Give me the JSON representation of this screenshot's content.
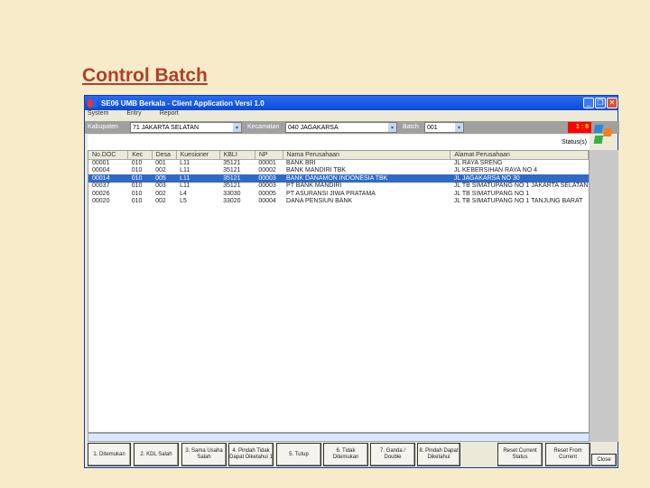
{
  "slide_title": "Control Batch",
  "window": {
    "title": "SE06 UMB Berkala - Client Application Versi 1.0"
  },
  "menu": [
    "System",
    "Entry",
    "Report"
  ],
  "filter": {
    "kab_label": "Kabupaten",
    "kab_value": "71 JAKARTA SELATAN",
    "kec_label": "Kecamatan",
    "kec_value": "040 JAGAKARSA",
    "batch_label": "Batch",
    "batch_value": "001",
    "total": "1 : 8"
  },
  "status_label": "Status(s)",
  "table": {
    "headers": [
      "No.DOC",
      "Kec",
      "Desa",
      "Kuesioner",
      "KBLI",
      "NP",
      "Nama Perusahaan",
      "Alamat Perusahaan"
    ],
    "rows": [
      [
        "00001",
        "010",
        "001",
        "L11",
        "35121",
        "00001",
        "BANK BRI",
        "JL RAYA SRENG"
      ],
      [
        "00004",
        "010",
        "002",
        "L11",
        "35121",
        "00002",
        "BANK MANDIRI TBK",
        "JL KEBERSIHAN RAYA NO 4"
      ],
      [
        "00014",
        "010",
        "005",
        "L11",
        "35121",
        "00003",
        "BANK DANAMON INDONESIA TBK",
        "JL JAGAKARSA NO 30"
      ],
      [
        "00037",
        "010",
        "003",
        "L11",
        "35121",
        "00003",
        "PT BANK MANDIRI",
        "JL TB SIMATUPANG NO 1 JAKARTA SELATAN"
      ],
      [
        "00026",
        "010",
        "002",
        "L4",
        "33030",
        "00005",
        "PT ASURANSI JIWA PRATAMA",
        "JL TB SIMATUPANG NO 1"
      ],
      [
        "00020",
        "010",
        "002",
        "L5",
        "33020",
        "00004",
        "DANA PENSIUN BANK",
        "JL TB SIMATUPANG NO 1 TANJUNG BARAT"
      ]
    ]
  },
  "selected_row": 2,
  "buttons": [
    "1. Ditemukan",
    "2. KDL Salah",
    "3. Sama Usaha Salah",
    "4. Pindah Tidak Dapat Diketahui 1",
    "5. Tutup",
    "6. Tidak Ditemukan",
    "7. Ganda / Double",
    "8. Pindah Dapat Diketahui",
    "Reset Current Status",
    "Reset From Current",
    "Close"
  ]
}
